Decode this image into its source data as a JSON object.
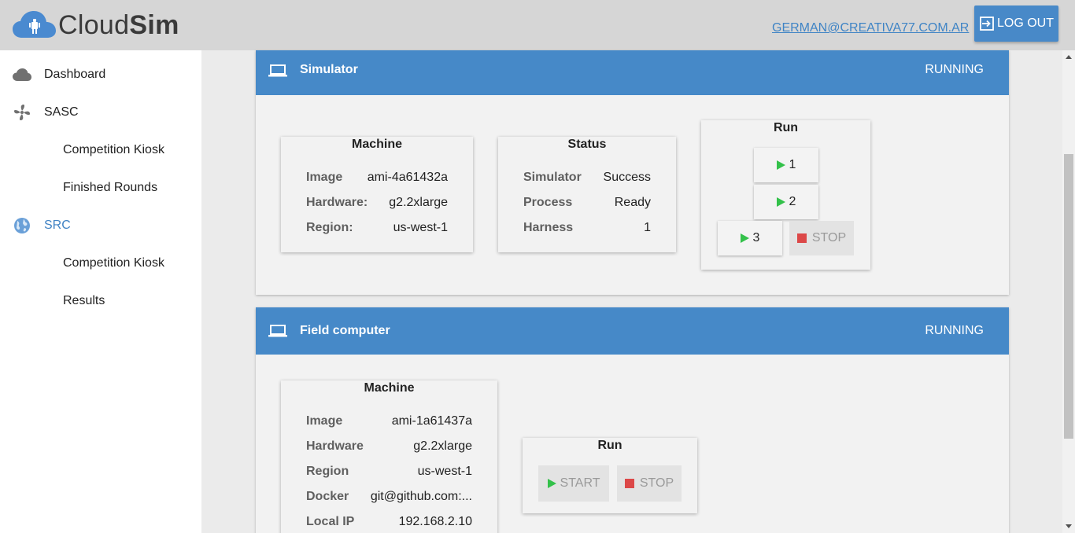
{
  "header": {
    "logo_light": "Cloud",
    "logo_bold": "Sim",
    "user_email": "GERMAN@CREATIVA77.COM.AR",
    "logout_label": "LOG OUT"
  },
  "sidebar": {
    "items": [
      {
        "label": "Dashboard",
        "icon": "cloud-icon"
      },
      {
        "label": "SASC",
        "icon": "fan-icon"
      },
      {
        "label": "Competition Kiosk"
      },
      {
        "label": "Finished Rounds"
      },
      {
        "label": "SRC",
        "icon": "globe-icon",
        "active": true
      },
      {
        "label": "Competition Kiosk"
      },
      {
        "label": "Results"
      }
    ]
  },
  "simulator": {
    "title": "Simulator",
    "state": "RUNNING",
    "machine": {
      "title": "Machine",
      "rows": [
        {
          "label": "Image",
          "value": "ami-4a61432a"
        },
        {
          "label": "Hardware:",
          "value": "g2.2xlarge"
        },
        {
          "label": "Region:",
          "value": "us-west-1"
        }
      ]
    },
    "status": {
      "title": "Status",
      "rows": [
        {
          "label": "Simulator",
          "value": "Success"
        },
        {
          "label": "Process",
          "value": "Ready"
        },
        {
          "label": "Harness",
          "value": "1"
        }
      ]
    },
    "run": {
      "title": "Run",
      "buttons": [
        "1",
        "2",
        "3"
      ],
      "stop_label": "STOP"
    }
  },
  "field_computer": {
    "title": "Field computer",
    "state": "RUNNING",
    "machine": {
      "title": "Machine",
      "rows": [
        {
          "label": "Image",
          "value": "ami-1a61437a"
        },
        {
          "label": "Hardware",
          "value": "g2.2xlarge"
        },
        {
          "label": "Region",
          "value": "us-west-1"
        },
        {
          "label": "Docker",
          "value": "git@github.com:..."
        },
        {
          "label": "Local IP",
          "value": "192.168.2.10"
        }
      ]
    },
    "run": {
      "title": "Run",
      "start_label": "START",
      "stop_label": "STOP"
    }
  },
  "colors": {
    "header_bg": "#d6d6d6",
    "card_header": "#4689c8",
    "accent": "#4183c4",
    "play": "#33c14a",
    "stop": "#dc4848"
  }
}
